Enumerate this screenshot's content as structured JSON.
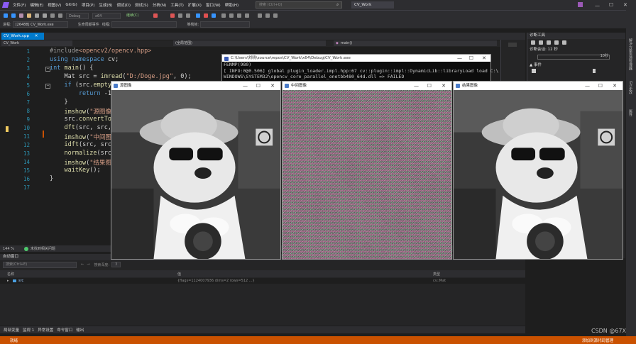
{
  "menubar": {
    "items": [
      "文件(F)",
      "编辑(E)",
      "视图(V)",
      "Git(G)",
      "项目(P)",
      "生成(B)",
      "调试(D)",
      "测试(S)",
      "分析(N)",
      "工具(T)",
      "扩展(X)",
      "窗口(W)",
      "帮助(H)"
    ],
    "search_placeholder": "搜索 (Ctrl+Q)",
    "solution_title": "CV_Work",
    "live_share": "Live Share"
  },
  "toolbar": {
    "config": "Debug",
    "platform": "x64",
    "continue": "继续(C)",
    "process_label": "进程:",
    "process_value": "[26488] CV_Work.exe",
    "lifecycle": "生命周期事件",
    "thread_label": "线程:",
    "stack_label": "堆栈帧:"
  },
  "tabs": {
    "active": "CV_Work.cpp"
  },
  "nav": {
    "project": "CV_Work",
    "scope": "(全局范围)",
    "func": "main()"
  },
  "code": {
    "lines": [
      "1",
      "2",
      "3",
      "4",
      "5",
      "6",
      "7",
      "8",
      "9",
      "10",
      "11",
      "12",
      "13",
      "14",
      "15",
      "16",
      "17"
    ]
  },
  "console": {
    "title": "C:\\Users\\刘晓\\source\\repos\\CV_Work\\x64\\Debug\\CV_Work.exe",
    "lines": [
      "FENMP(980)",
      "[ INFO:0@0.506] global plugin_loader.impl.hpp:67 cv::plugin::impl::DynamicLib::libraryLoad load C:\\",
      "WINDOWS\\SYSTEM32\\opencv_core_parallel_onetbb480_64d.dll => FAILED"
    ]
  },
  "windows": {
    "src": "源图像",
    "mid": "中间图像",
    "res": "结果图像"
  },
  "rightpanel": {
    "title": "诊断工具",
    "session": "诊断会话: 12 秒",
    "time_mark": "10秒",
    "events": "▲ 事件"
  },
  "editor_status": {
    "zoom": "144 %",
    "issues": "未找到相关问题"
  },
  "autos": {
    "title": "自动窗口",
    "search_placeholder": "搜索(Ctrl+E)",
    "depth_label": "搜索深度:",
    "depth_value": "3",
    "col_name": "名称",
    "col_value": "值",
    "col_type": "类型",
    "row_name": "src",
    "row_value": "{flags=1124007936 dims=2 rows=512 ...}",
    "row_type": "cv::Mat"
  },
  "bottom_tabs": [
    "局部变量",
    "监视 1",
    "异常设置",
    "命令窗口",
    "输出"
  ],
  "status": {
    "left": "就绪",
    "right": "添加到源代码管理"
  },
  "watermark": "CSDN @67X"
}
